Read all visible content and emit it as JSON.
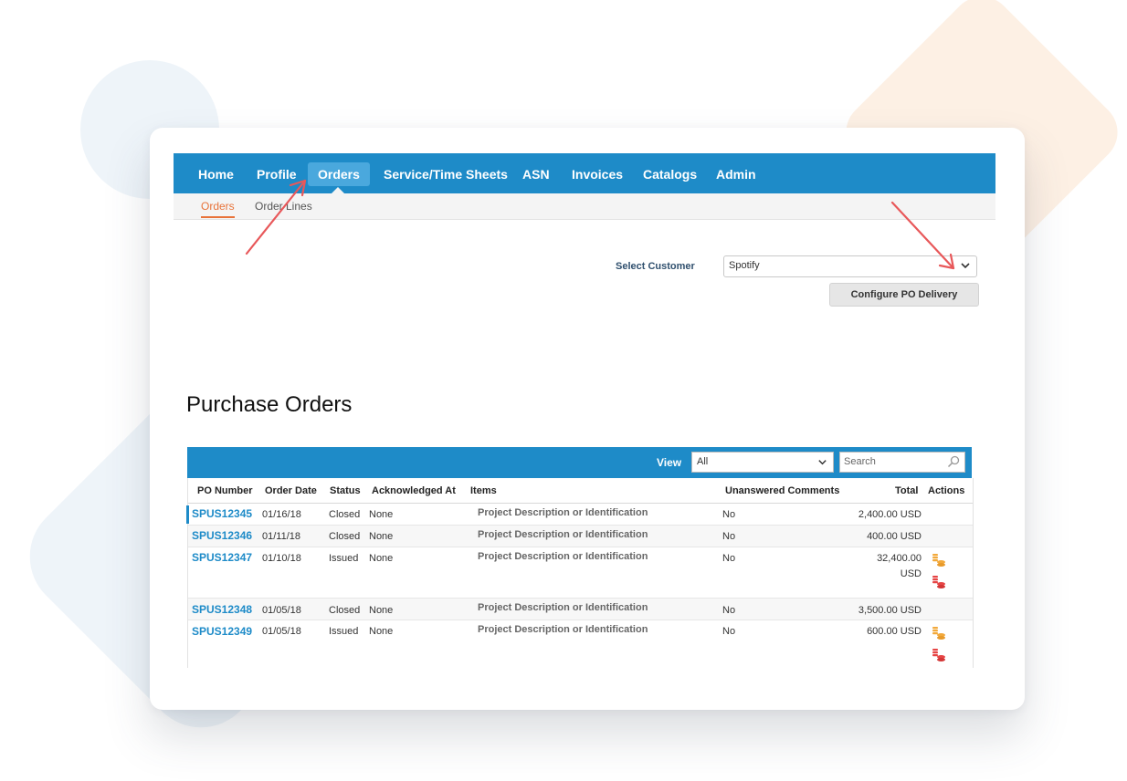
{
  "nav": {
    "items": [
      {
        "label": "Home"
      },
      {
        "label": "Profile"
      },
      {
        "label": "Orders"
      },
      {
        "label": "Service/Time Sheets"
      },
      {
        "label": "ASN"
      },
      {
        "label": "Invoices"
      },
      {
        "label": "Catalogs"
      },
      {
        "label": "Admin"
      }
    ],
    "active": "Orders"
  },
  "subnav": {
    "items": [
      {
        "label": "Orders"
      },
      {
        "label": "Order Lines"
      }
    ],
    "active": "Orders"
  },
  "customer": {
    "label": "Select Customer",
    "value": "Spotify",
    "button": "Configure PO Delivery"
  },
  "page_title": "Purchase Orders",
  "table": {
    "view_label": "View",
    "view_value": "All",
    "search_placeholder": "Search",
    "columns": [
      "PO Number",
      "Order Date",
      "Status",
      "Acknowledged At",
      "Items",
      "Unanswered Comments",
      "Total",
      "Actions"
    ],
    "rows": [
      {
        "po": "SPUS12345",
        "date": "01/16/18",
        "status": "Closed",
        "ack": "None",
        "items": "Project Description or Identification",
        "comments": "No",
        "total": "2,400.00 USD"
      },
      {
        "po": "SPUS12346",
        "date": "01/11/18",
        "status": "Closed",
        "ack": "None",
        "items": "Project Description or Identification",
        "comments": "No",
        "total": "400.00 USD"
      },
      {
        "po": "SPUS12347",
        "date": "01/10/18",
        "status": "Issued",
        "ack": "None",
        "items": "Project Description or Identification",
        "comments": "No",
        "total_line1": "32,400.00",
        "total_line2": "USD"
      },
      {
        "po": "SPUS12348",
        "date": "01/05/18",
        "status": "Closed",
        "ack": "None",
        "items": "Project Description or Identification",
        "comments": "No",
        "total": "3,500.00 USD"
      },
      {
        "po": "SPUS12349",
        "date": "01/05/18",
        "status": "Issued",
        "ack": "None",
        "items": "Project Description or Identification",
        "comments": "No",
        "total": "600.00 USD"
      }
    ]
  },
  "icons": {
    "dropdown": "chevron-down-icon",
    "search": "magnifier-icon",
    "action_primary": "coin-stack-orange-icon",
    "action_secondary": "coin-stack-red-icon"
  },
  "colors": {
    "nav_bg": "#1e8bc8",
    "nav_active": "#4aa8dd",
    "link": "#1e8bc8",
    "subnav_active": "#e8733a",
    "annotation_arrow": "#e8585a",
    "coin_orange": "#f2a93b",
    "coin_red": "#e64545"
  }
}
